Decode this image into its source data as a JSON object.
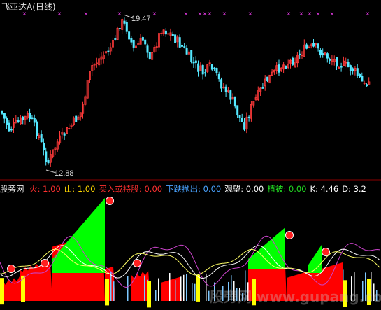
{
  "title": {
    "name": "飞亚达A",
    "period": "(日线)"
  },
  "price_labels": {
    "high": "19.47",
    "low": "12.88"
  },
  "indicator": {
    "name": "股旁网",
    "items": [
      {
        "label": "火:",
        "value": "1.00",
        "color": "#ff3030"
      },
      {
        "label": "山:",
        "value": "1.00",
        "color": "#ffd700"
      },
      {
        "label": "买入或持股:",
        "value": "0.00",
        "color": "#ff3030"
      },
      {
        "label": "下跌抛出:",
        "value": "0.00",
        "color": "#4aa3ff"
      },
      {
        "label": "观望:",
        "value": "0.00",
        "color": "#ffffff"
      },
      {
        "label": "植被:",
        "value": "0.00",
        "color": "#22dd22"
      },
      {
        "label": "K:",
        "value": "4.46",
        "color": "#ffffff"
      },
      {
        "label": "D:",
        "value": "3.2",
        "color": "#ffffff"
      }
    ]
  },
  "watermark": "股旁网 www.gupang.com",
  "colors": {
    "up": "#ff3a3a",
    "down": "#54e8ff",
    "marker": "#ff40ff",
    "green": "#00ff00",
    "red": "#ff0000",
    "yellow": "#ffff00",
    "magenta": "#cc44cc",
    "white": "#ffffff"
  }
}
